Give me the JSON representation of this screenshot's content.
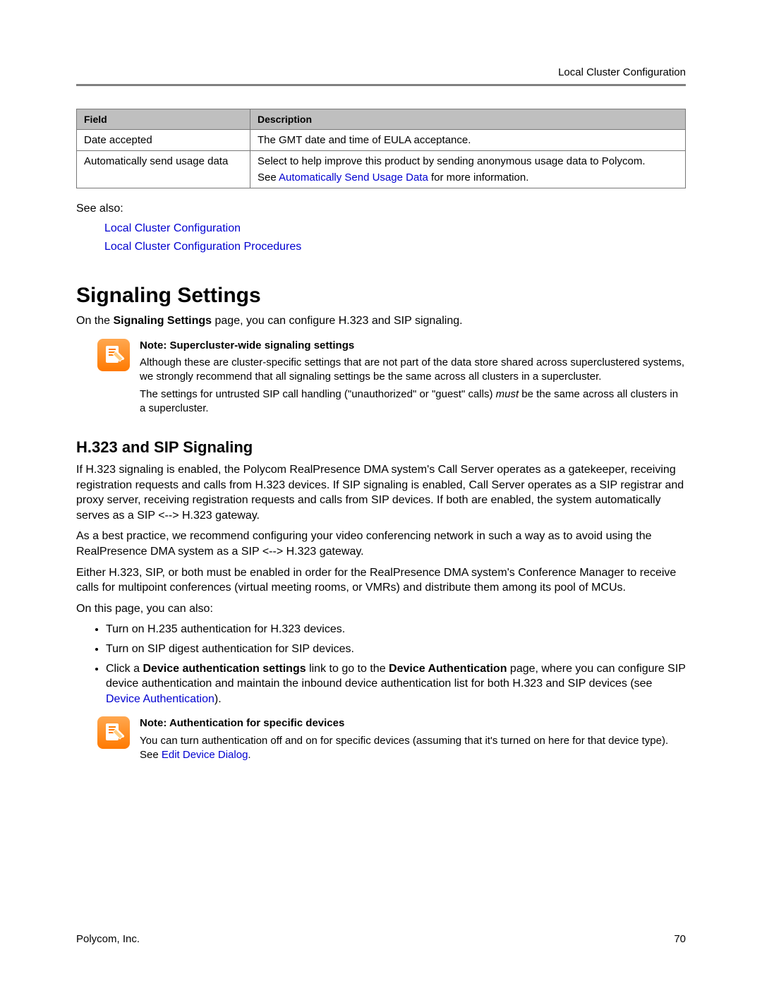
{
  "header": {
    "breadcrumb": "Local Cluster Configuration"
  },
  "table": {
    "headers": {
      "field": "Field",
      "description": "Description"
    },
    "rows": [
      {
        "field": "Date accepted",
        "desc": "The GMT date and time of EULA acceptance."
      },
      {
        "field": "Automatically send usage data",
        "desc_part1": "Select to help improve this product by sending anonymous usage data to Polycom.",
        "desc_part2a": "See ",
        "desc_link": "Automatically Send Usage Data",
        "desc_part2b": " for more information."
      }
    ]
  },
  "see_also": {
    "label": "See also:",
    "links": [
      "Local Cluster Configuration",
      "Local Cluster Configuration Procedures"
    ]
  },
  "section": {
    "title": "Signaling Settings",
    "intro_a": "On the ",
    "intro_bold": "Signaling Settings",
    "intro_b": " page, you can configure H.323 and SIP signaling."
  },
  "note1": {
    "title": "Note: Supercluster-wide signaling settings",
    "p1": "Although these are cluster-specific settings that are not part of the data store shared across superclustered systems, we strongly recommend that all signaling settings be the same across all clusters in a supercluster.",
    "p2a": "The settings for untrusted SIP call handling (\"unauthorized\" or \"guest\" calls) ",
    "p2_em": "must",
    "p2b": " be the same across all clusters in a supercluster."
  },
  "subsection": {
    "title": "H.323 and SIP Signaling",
    "p1": "If H.323 signaling is enabled, the Polycom RealPresence DMA system's Call Server operates as a gatekeeper, receiving registration requests and calls from H.323 devices. If SIP signaling is enabled, Call Server operates as a SIP registrar and proxy server, receiving registration requests and calls from SIP devices. If both are enabled, the system automatically serves as a SIP <--> H.323 gateway.",
    "p2": "As a best practice, we recommend configuring your video conferencing network in such a way as to avoid using the RealPresence DMA system as a SIP <--> H.323 gateway.",
    "p3": "Either H.323, SIP, or both must be enabled in order for the RealPresence DMA system's Conference Manager to receive calls for multipoint conferences (virtual meeting rooms, or VMRs) and distribute them among its pool of MCUs.",
    "p4": "On this page, you can also:",
    "bullets": {
      "b1": "Turn on H.235 authentication for H.323 devices.",
      "b2": "Turn on SIP digest authentication for SIP devices.",
      "b3a": "Click a ",
      "b3_bold1": "Device authentication settings",
      "b3b": " link to go to the ",
      "b3_bold2": "Device Authentication",
      "b3c": " page, where you can configure SIP device authentication and maintain the inbound device authentication list for both H.323 and SIP devices (see ",
      "b3_link": "Device Authentication",
      "b3d": ")."
    }
  },
  "note2": {
    "title": "Note: Authentication for specific devices",
    "p1a": "You can turn authentication off and on for specific devices (assuming that it's turned on here for that device type). See ",
    "p1_link": "Edit Device Dialog",
    "p1b": "."
  },
  "footer": {
    "company": "Polycom, Inc.",
    "page": "70"
  }
}
